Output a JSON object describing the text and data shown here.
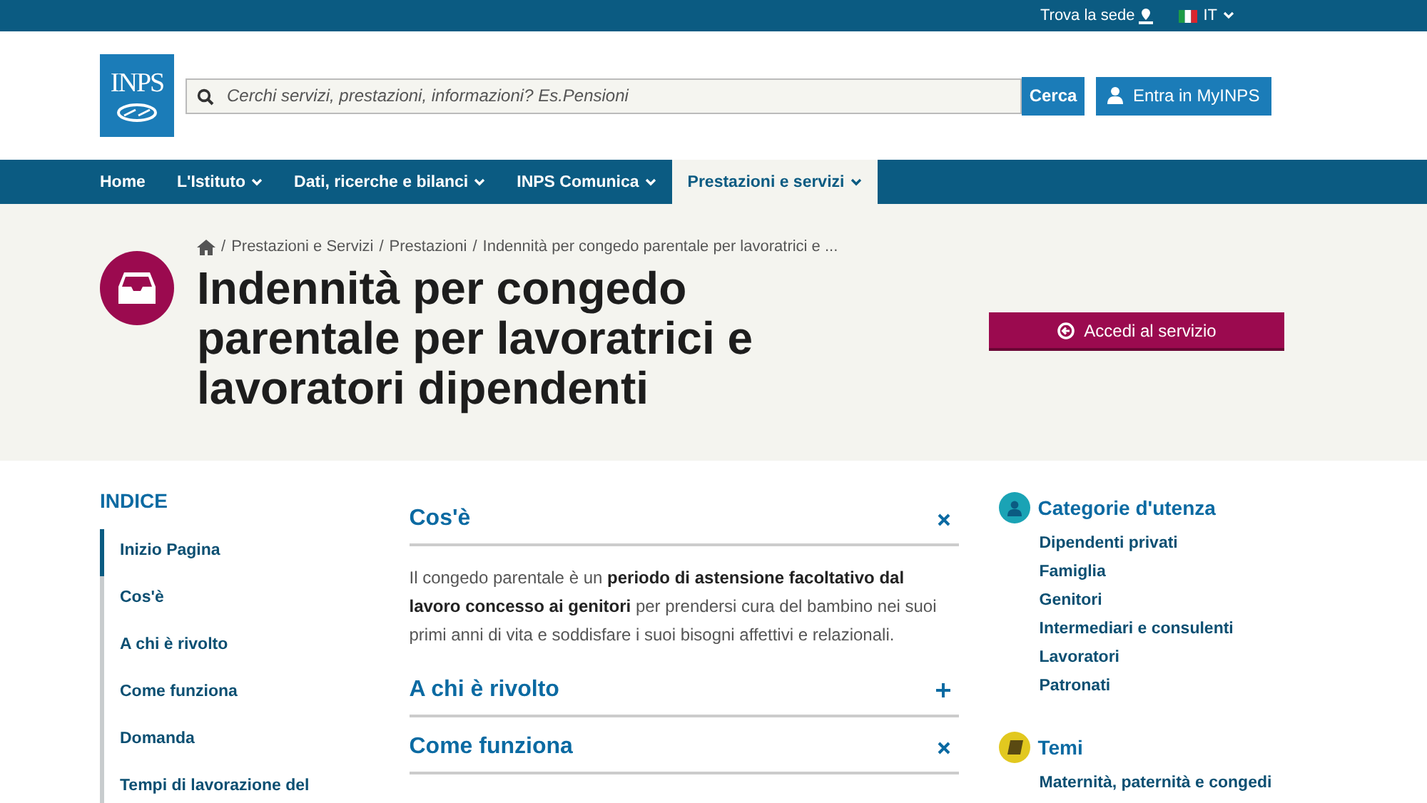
{
  "top_bar": {
    "find_office": "Trova la sede",
    "language": "IT"
  },
  "header": {
    "logo": "INPS",
    "search": {
      "placeholder": "Cerchi servizi, prestazioni, informazioni? Es.Pensioni",
      "button": "Cerca"
    },
    "login_button": "Entra in MyINPS"
  },
  "nav": [
    {
      "label": "Home",
      "has_menu": false,
      "selected": false
    },
    {
      "label": "L'Istituto",
      "has_menu": true,
      "selected": false
    },
    {
      "label": "Dati, ricerche e bilanci",
      "has_menu": true,
      "selected": false
    },
    {
      "label": "INPS Comunica",
      "has_menu": true,
      "selected": false
    },
    {
      "label": "Prestazioni e servizi",
      "has_menu": true,
      "selected": true
    }
  ],
  "breadcrumb": {
    "separator": "/",
    "items": [
      "Prestazioni e Servizi",
      "Prestazioni",
      "Indennità per congedo parentale per lavoratrici e ..."
    ]
  },
  "title": "Indennità per congedo parentale per lavoratrici e lavoratori dipendenti",
  "service_button": "Accedi al servizio",
  "index": {
    "heading": "INDICE",
    "items": [
      {
        "label": "Inizio Pagina",
        "selected": true
      },
      {
        "label": "Cos'è",
        "selected": false
      },
      {
        "label": "A chi è rivolto",
        "selected": false
      },
      {
        "label": "Come funziona",
        "selected": false
      },
      {
        "label": "Domanda",
        "selected": false
      },
      {
        "label": "Tempi di lavorazione del",
        "selected": false
      }
    ]
  },
  "sections": [
    {
      "title": "Cos'è",
      "expanded": true,
      "text": "Il congedo parentale è un **periodo di astensione facoltativo dal lavoro concesso ai genitori** per prendersi cura del bambino nei suoi primi anni di vita e soddisfare i suoi bisogni affettivi e relazionali."
    },
    {
      "title": "A chi è rivolto",
      "expanded": false
    },
    {
      "title": "Come funziona",
      "expanded": true
    }
  ],
  "side_groups": [
    {
      "kind": "users",
      "title": "Categorie d'utenza",
      "color": "#1aa3b5",
      "links": [
        "Dipendenti privati",
        "Famiglia",
        "Genitori",
        "Intermediari e consulenti",
        "Lavoratori",
        "Patronati"
      ]
    },
    {
      "kind": "topics",
      "title": "Temi",
      "color": "#e2c81f",
      "links": [
        "Maternità, paternità e congedi"
      ]
    }
  ]
}
